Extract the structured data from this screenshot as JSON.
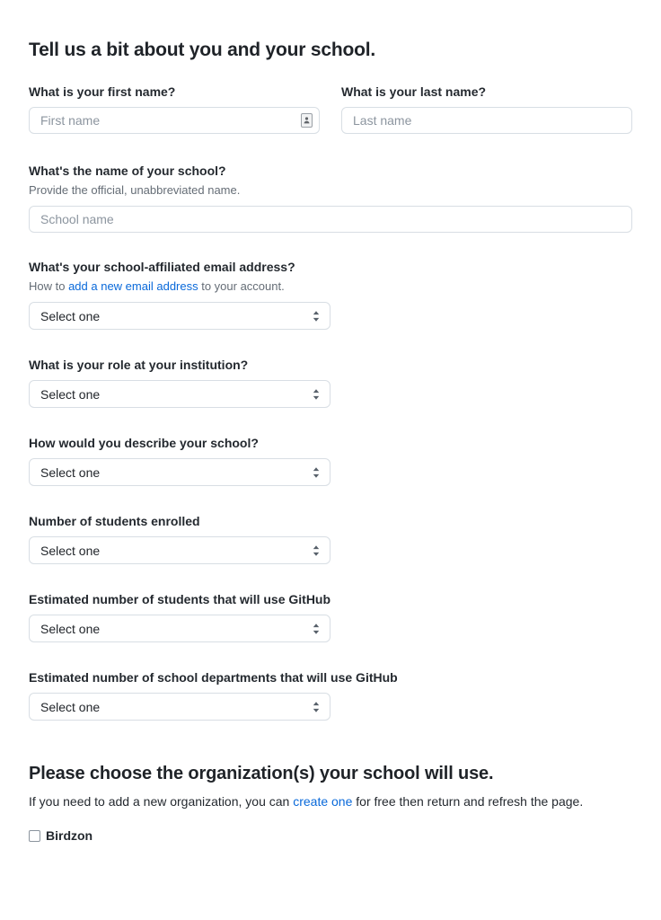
{
  "page": {
    "title": "Tell us a bit about you and your school."
  },
  "colors": {
    "link": "#0969da",
    "text": "#24292f",
    "muted": "#656d76",
    "border": "#d8dee4",
    "background": "#ffffff"
  },
  "fields": {
    "first_name": {
      "label": "What is your first name?",
      "placeholder": "First name",
      "value": ""
    },
    "last_name": {
      "label": "What is your last name?",
      "placeholder": "Last name",
      "value": ""
    },
    "school_name": {
      "label": "What's the name of your school?",
      "caption": "Provide the official, unabbreviated name.",
      "placeholder": "School name",
      "value": ""
    },
    "email": {
      "label": "What's your school-affiliated email address?",
      "caption_before": "How to ",
      "caption_link": "add a new email address",
      "caption_after": " to your account.",
      "value": "Select one"
    },
    "role": {
      "label": "What is your role at your institution?",
      "value": "Select one"
    },
    "school_type": {
      "label": "How would you describe your school?",
      "value": "Select one"
    },
    "students_enrolled": {
      "label": "Number of students enrolled",
      "value": "Select one"
    },
    "students_using_github": {
      "label": "Estimated number of students that will use GitHub",
      "value": "Select one"
    },
    "departments_using_github": {
      "label": "Estimated number of school departments that will use GitHub",
      "value": "Select one"
    }
  },
  "organizations": {
    "title": "Please choose the organization(s) your school will use.",
    "caption_before": "If you need to add a new organization, you can ",
    "caption_link": "create one",
    "caption_after": " for free then return and refresh the page.",
    "items": [
      {
        "label": "Birdzon",
        "checked": false
      }
    ]
  }
}
